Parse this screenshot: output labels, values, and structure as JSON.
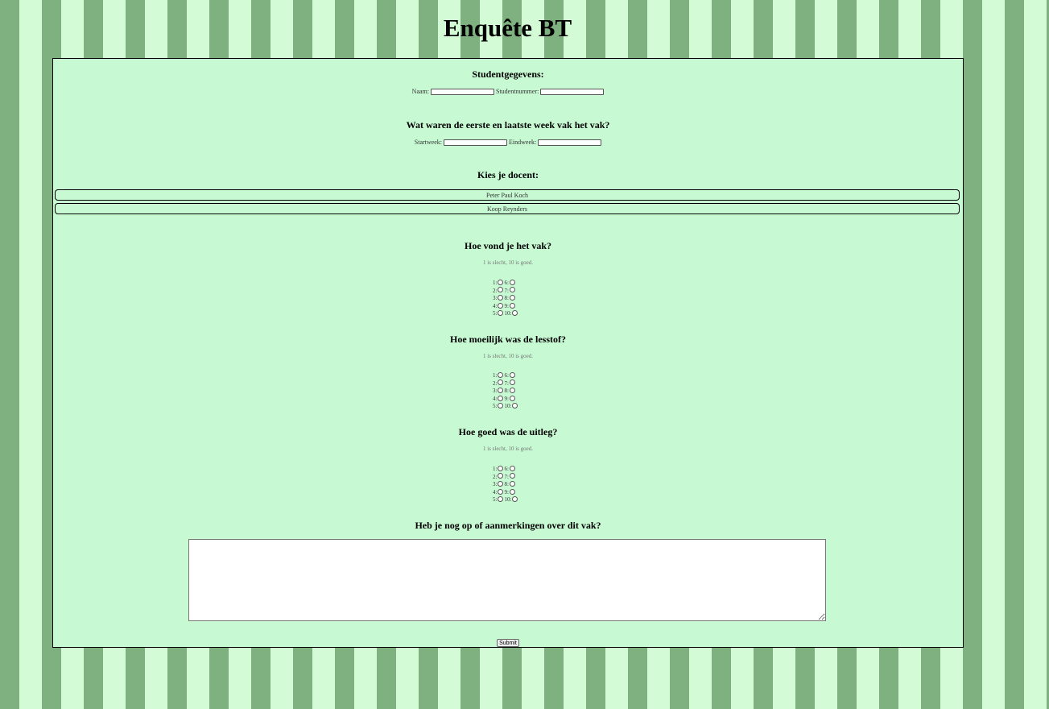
{
  "page": {
    "title": "Enquête BT"
  },
  "student": {
    "heading": "Studentgegevens:",
    "name_label": "Naam:",
    "name_value": "",
    "number_label": "Studentnummer:",
    "number_value": ""
  },
  "weeks": {
    "heading": "Wat waren de eerste en laatste week vak het vak?",
    "start_label": "Startweek:",
    "start_value": "",
    "end_label": "Eindweek:",
    "end_value": ""
  },
  "teacher": {
    "heading": "Kies je docent:",
    "options": [
      "Peter Paul Koch",
      "Koop Reynders"
    ]
  },
  "questions": [
    {
      "heading": "Hoe vond je het vak?",
      "hint": "1 is slecht, 10 is goed."
    },
    {
      "heading": "Hoe moeilijk was de lesstof?",
      "hint": "1 is slecht, 10 is goed."
    },
    {
      "heading": "Hoe goed was de uitleg?",
      "hint": "1 is slecht, 10 is goed."
    }
  ],
  "rating_labels": [
    "1:",
    "2:",
    "3:",
    "4:",
    "5:",
    "6:",
    "7:",
    "8:",
    "9:",
    "10:"
  ],
  "comments": {
    "heading": "Heb je nog op of aanmerkingen over dit vak?",
    "value": ""
  },
  "submit_label": "Submit",
  "colors": {
    "stripe_dark": "#7fb07f",
    "stripe_light": "#d3fcd6",
    "panel_bg": "#c7f9d3"
  }
}
